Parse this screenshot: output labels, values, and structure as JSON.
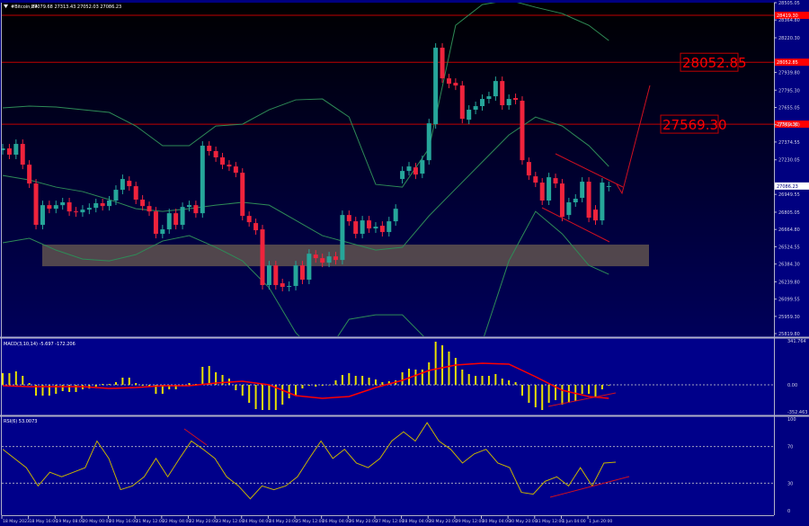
{
  "header": {
    "symbol": "#Bitcoin,H4",
    "ohlc": "27079.68 27313.43 27052.03 27086.23"
  },
  "colors": {
    "bull": "#26a69a",
    "bear": "#ef233c",
    "band": "#2e8b57",
    "level": "#c00000",
    "macd_hist": "#e8e000",
    "macd_signal": "#ff0000",
    "rsi": "#c8b400"
  },
  "chart_data": [
    {
      "type": "candlestick",
      "title": "#Bitcoin,H4",
      "ylim": [
        25819.8,
        28505.05
      ],
      "price_axis": [
        "28505.05",
        "28364.80",
        "28220.30",
        "27939.80",
        "27795.30",
        "27655.05",
        "27514.80",
        "27374.55",
        "27230.05",
        "26949.55",
        "26805.05",
        "26664.80",
        "26524.55",
        "26384.30",
        "26239.80",
        "26099.55",
        "25959.30",
        "25819.80"
      ],
      "x_labels": [
        "18 May 2023",
        "18 May 16:00",
        "19 May 08:00",
        "20 May 00:00",
        "20 May 16:00",
        "21 May 12:00",
        "22 May 04:00",
        "22 May 20:00",
        "23 May 12:00",
        "24 May 04:00",
        "24 May 20:00",
        "25 May 12:00",
        "26 May 04:00",
        "26 May 20:00",
        "27 May 12:00",
        "28 May 04:00",
        "28 May 20:00",
        "29 May 12:00",
        "30 May 04:00",
        "30 May 20:00",
        "31 May 12:00",
        "1 Jun 04:00",
        "1 Jun 20:00"
      ],
      "candles_oc": [
        [
          27366,
          27380
        ],
        [
          27380,
          27331
        ],
        [
          27331,
          27415
        ],
        [
          27415,
          27253
        ],
        [
          27253,
          27106
        ],
        [
          27106,
          26783
        ],
        [
          26783,
          26937
        ],
        [
          26937,
          26909
        ],
        [
          26909,
          26937
        ],
        [
          26937,
          26959
        ],
        [
          26959,
          26888
        ],
        [
          26888,
          26881
        ],
        [
          26881,
          26902
        ],
        [
          26902,
          26916
        ],
        [
          26916,
          26952
        ],
        [
          26952,
          26930
        ],
        [
          26930,
          26973
        ],
        [
          26973,
          27057
        ],
        [
          27057,
          27141
        ],
        [
          27127,
          27085
        ],
        [
          27085,
          26980
        ],
        [
          26980,
          26930
        ],
        [
          26930,
          26888
        ],
        [
          26888,
          26713
        ],
        [
          26713,
          26748
        ],
        [
          26748,
          26874
        ],
        [
          26874,
          26783
        ],
        [
          26783,
          26923
        ],
        [
          26923,
          26937
        ],
        [
          26937,
          26874
        ],
        [
          26874,
          27401
        ],
        [
          27401,
          27359
        ],
        [
          27359,
          27310
        ],
        [
          27310,
          27253
        ],
        [
          27253,
          27239
        ],
        [
          27239,
          27190
        ],
        [
          27190,
          26853
        ],
        [
          26853,
          26804
        ],
        [
          26797,
          26741
        ],
        [
          26748,
          26313
        ],
        [
          26313,
          26467
        ],
        [
          26467,
          26313
        ],
        [
          26327,
          26299
        ],
        [
          26299,
          26306
        ],
        [
          26306,
          26467
        ],
        [
          26467,
          26355
        ],
        [
          26355,
          26558
        ],
        [
          26551,
          26523
        ],
        [
          26523,
          26488
        ],
        [
          26488,
          26537
        ],
        [
          26537,
          26509
        ],
        [
          26509,
          26860
        ],
        [
          26860,
          26811
        ],
        [
          26811,
          26713
        ],
        [
          26713,
          26818
        ],
        [
          26818,
          26755
        ],
        [
          26755,
          26769
        ],
        [
          26776,
          26727
        ],
        [
          26727,
          26811
        ],
        [
          26811,
          26909
        ],
        [
          27141,
          27204
        ],
        [
          27204,
          27239
        ],
        [
          27232,
          27176
        ],
        [
          27183,
          27288
        ],
        [
          27288,
          27576
        ],
        [
          27569,
          28166
        ],
        [
          28166,
          27927
        ],
        [
          27927,
          27885
        ],
        [
          27892,
          27871
        ],
        [
          27871,
          27611
        ],
        [
          27604,
          27682
        ],
        [
          27682,
          27710
        ],
        [
          27710,
          27766
        ],
        [
          27766,
          27787
        ],
        [
          27787,
          27906
        ],
        [
          27906,
          27717
        ],
        [
          27717,
          27766
        ],
        [
          27773,
          27759
        ],
        [
          27752,
          27288
        ],
        [
          27274,
          27169
        ],
        [
          27162,
          27113
        ],
        [
          27113,
          26973
        ],
        [
          26973,
          27155
        ],
        [
          27148,
          27106
        ],
        [
          27106,
          26846
        ],
        [
          26860,
          26959
        ],
        [
          26959,
          26987
        ],
        [
          26994,
          27120
        ],
        [
          27120,
          26839
        ],
        [
          26902,
          26818
        ],
        [
          26818,
          27113
        ],
        [
          27080,
          27086
        ]
      ],
      "bollinger_sample_every": 4,
      "bollinger_upper": [
        27696,
        27710,
        27703,
        27682,
        27661,
        27555,
        27401,
        27401,
        27555,
        27569,
        27682,
        27759,
        27766,
        27625,
        27099,
        27078,
        27380,
        28341,
        28503,
        28538,
        28482,
        28433,
        28341,
        28222
      ],
      "bollinger_middle": [
        27169,
        27134,
        27078,
        27043,
        26980,
        26909,
        26888,
        26909,
        26937,
        26959,
        26937,
        26818,
        26699,
        26643,
        26586,
        26608,
        26853,
        27064,
        27274,
        27485,
        27625,
        27555,
        27401,
        27239
      ],
      "bollinger_lower": [
        26643,
        26678,
        26586,
        26516,
        26502,
        26551,
        26657,
        26699,
        26608,
        26502,
        26292,
        25941,
        25730,
        26046,
        26081,
        26081,
        25870,
        25730,
        25870,
        26502,
        26888,
        26713,
        26467,
        26397
      ],
      "levels": [
        {
          "value": 28419.3,
          "axis_label": "28419.30"
        },
        {
          "value": 28052.85,
          "label": "28052.85",
          "axis_label": "28052.85"
        },
        {
          "value": 27569.3,
          "label": "27569.30",
          "axis_label": "27569.30"
        }
      ],
      "current_price": "27086.23",
      "support_zone": [
        26460,
        26629
      ]
    },
    {
      "type": "bar",
      "title": "MACD(3,10,14) -5.697 -172.206",
      "axis": [
        "341.764",
        "0.00",
        "-352.463"
      ],
      "ylim": [
        -352.463,
        341.764
      ],
      "histogram": [
        91,
        91,
        105,
        70,
        14,
        -84,
        -84,
        -84,
        -70,
        -49,
        -56,
        -56,
        -35,
        -28,
        -14,
        7,
        7,
        21,
        56,
        56,
        14,
        -7,
        -14,
        -70,
        -70,
        -35,
        -35,
        -7,
        14,
        7,
        140,
        147,
        98,
        77,
        49,
        -42,
        -84,
        -140,
        -189,
        -196,
        -196,
        -196,
        -154,
        -105,
        -84,
        -28,
        -7,
        -14,
        -7,
        0,
        35,
        77,
        91,
        70,
        70,
        56,
        42,
        21,
        28,
        35,
        98,
        126,
        119,
        119,
        175,
        336,
        308,
        259,
        210,
        119,
        84,
        70,
        70,
        70,
        84,
        49,
        35,
        21,
        -84,
        -140,
        -175,
        -196,
        -140,
        -119,
        -154,
        -140,
        -126,
        -70,
        -70,
        -91,
        -35,
        -6
      ],
      "signal_sample_every": 4,
      "signal": [
        -7,
        -14,
        -14,
        -14,
        -28,
        -21,
        -7,
        -7,
        14,
        28,
        0,
        -84,
        -105,
        -91,
        -21,
        35,
        112,
        154,
        168,
        161,
        63,
        -42,
        -91,
        -105
      ]
    },
    {
      "type": "line",
      "title": "RSI(6) 53.0073",
      "axis": [
        "100",
        "70",
        "30",
        "0"
      ],
      "ylim": [
        0,
        100
      ],
      "levels": [
        70,
        30
      ],
      "values": [
        67,
        57,
        47,
        27,
        42,
        37,
        42,
        47,
        76,
        57,
        23,
        27,
        37,
        57,
        37,
        57,
        76,
        67,
        57,
        37,
        27,
        13,
        27,
        23,
        27,
        37,
        57,
        76,
        57,
        67,
        52,
        47,
        57,
        76,
        86,
        76,
        96,
        76,
        67,
        52,
        62,
        67,
        52,
        47,
        20,
        18,
        32,
        37,
        27,
        47,
        27,
        52,
        53
      ]
    }
  ]
}
